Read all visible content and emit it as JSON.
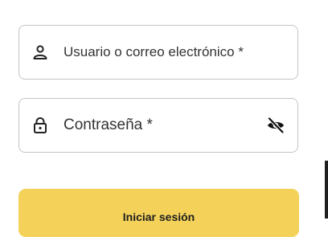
{
  "username_field": {
    "label": "Usuario o correo electrónico *",
    "icon": "user-icon"
  },
  "password_field": {
    "label": "Contraseña *",
    "icon": "lock-icon",
    "toggle_icon": "eye-off-icon"
  },
  "login_button": {
    "label": "Iniciar sesión"
  },
  "colors": {
    "button_background": "#f4d25a",
    "field_border": "#c4c4c4",
    "text": "#333333"
  }
}
